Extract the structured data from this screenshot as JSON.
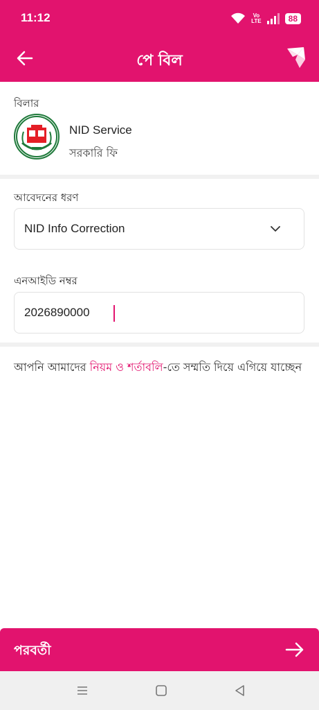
{
  "status_bar": {
    "time": "11:12",
    "volte_top": "Vo",
    "volte_bottom": "LTE",
    "battery": "88"
  },
  "header": {
    "title": "পে বিল",
    "back_icon": "arrow-left-icon",
    "logo_icon": "bird-logo-icon",
    "color": "#e2136e"
  },
  "biller": {
    "label": "বিলার",
    "name": "NID Service",
    "type": "সরকারি ফি",
    "logo_icon": "election-commission-logo"
  },
  "form": {
    "application_type_label": "আবেদনের ধরণ",
    "application_type_value": "NID Info Correction",
    "nid_label": "এনআইডি নম্বর",
    "nid_value": "2026890000"
  },
  "terms": {
    "prefix": "আপনি আমাদের ",
    "link": "নিয়ম ও শর্তাবলি",
    "suffix": "-তে সম্মতি দিয়ে এগিয়ে যাচ্ছেন"
  },
  "next_button": {
    "label": "পরবর্তী",
    "icon": "arrow-right-icon"
  },
  "nav_bar": {
    "menu_icon": "menu-icon",
    "home_icon": "home-square-icon",
    "back_icon": "back-triangle-icon"
  }
}
